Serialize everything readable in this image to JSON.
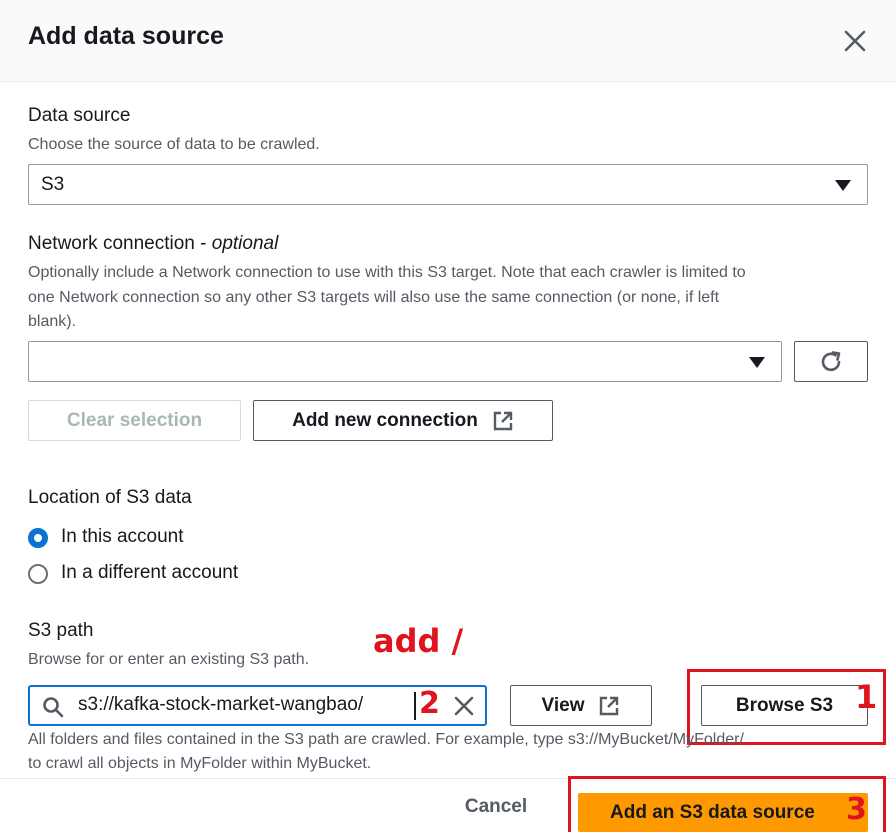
{
  "dialog": {
    "title": "Add data source"
  },
  "data_source": {
    "label": "Data source",
    "description": "Choose the source of data to be crawled.",
    "value": "S3"
  },
  "network": {
    "label": "Network connection",
    "optional": "optional",
    "description_lines": [
      "Optionally include a Network connection to use with this S3 target. Note that each crawler is limited to",
      "one Network connection so any other S3 targets will also use the same connection (or none, if left",
      "blank)."
    ],
    "value": "",
    "clear_label": "Clear selection",
    "add_label": "Add new connection"
  },
  "location": {
    "label": "Location of S3 data",
    "options": [
      "In this account",
      "In a different account"
    ],
    "selected": 0
  },
  "s3_path": {
    "label": "S3 path",
    "description": "Browse for or enter an existing S3 path.",
    "value": "s3://kafka-stock-market-wangbao/",
    "view_label": "View",
    "browse_label": "Browse S3",
    "help_lines": [
      "All folders and files contained in the S3 path are crawled. For example, type s3://MyBucket/MyFolder/",
      "to crawl all objects in MyFolder within MyBucket."
    ]
  },
  "annotations": {
    "add_note": "add /",
    "step1": "1",
    "step2": "2",
    "step3": "3"
  },
  "footer": {
    "cancel_label": "Cancel",
    "submit_label": "Add an S3 data source"
  },
  "colors": {
    "accent": "#0972d3",
    "primary_button": "#ff9900",
    "annotation": "#e0141e"
  }
}
